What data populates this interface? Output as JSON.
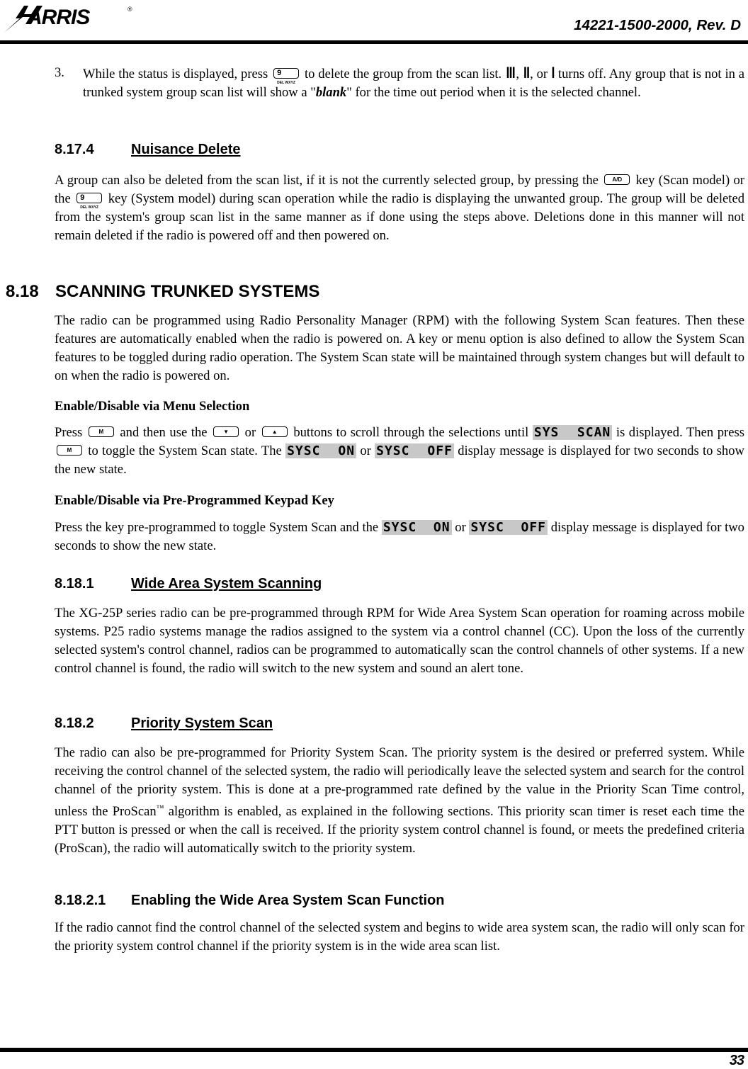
{
  "header": {
    "logo_text": "HARRIS",
    "registered_mark": "®",
    "doc_number": "14221-1500-2000, Rev. D"
  },
  "footer": {
    "page_number": "33"
  },
  "keys": {
    "nine_digit": "9",
    "nine_letters": "DEL WXYZ",
    "ad": "A/D",
    "m": "M",
    "down": "▼",
    "up": "▲"
  },
  "step3": {
    "number": "3.",
    "text_a": "While the status is displayed, press",
    "text_b": "to delete the group from the scan list.",
    "bars3": "III",
    "bars2": "II",
    "bars1": "I",
    "sep1": ", ",
    "sep2": ", or ",
    "text_c": " turns off. Any group that is not in a trunked system group scan list will show a \"",
    "blank": "blank",
    "text_d": "\" for the time out period when it is the selected channel."
  },
  "s8174": {
    "number": "8.17.4",
    "title": "Nuisance Delete",
    "p_a": "A group can also be deleted from the scan list, if it is not the currently selected group, by pressing the",
    "p_b": "key (Scan model) or the",
    "p_c": "key (System model) during scan operation while the radio is displaying the unwanted group. The group will be deleted from the system's group scan list in the same manner as if done using the steps above. Deletions done in this manner will not remain deleted if the radio is powered off and then powered on."
  },
  "s818": {
    "number": "8.18",
    "title": "SCANNING TRUNKED SYSTEMS",
    "intro": "The radio can be programmed using Radio Personality Manager (RPM) with the following System Scan features. Then these features are automatically enabled when the radio is powered on. A key or menu option is also defined to allow the System Scan features to be toggled during radio operation. The System Scan state will be maintained through system changes but will default to on when the radio is powered on.",
    "menu_heading": "Enable/Disable via Menu Selection",
    "menu_a": "Press",
    "menu_b": "and then use the",
    "menu_c": "or",
    "menu_d": "buttons to scroll through the selections until",
    "lcd_sys_scan": "SYS  SCAN",
    "menu_e": "is displayed. Then press",
    "menu_f": "to toggle the System Scan state. The",
    "lcd_sysc_on": "SYSC  ON",
    "menu_g": "or",
    "lcd_sysc_off": "SYSC  OFF",
    "menu_h": "display message is displayed for two seconds to show the new state.",
    "keypad_heading": "Enable/Disable via Pre-Programmed Keypad Key",
    "keypad_a": "Press the key pre-programmed to toggle System Scan and the",
    "keypad_b": "or",
    "keypad_c": "display message is displayed for two seconds to show the new state."
  },
  "s8181": {
    "number": "8.18.1",
    "title": "Wide Area System Scanning",
    "body": "The XG-25P series radio can be pre-programmed through RPM for Wide Area System Scan operation for roaming across mobile systems.  P25 radio systems manage the radios assigned to the system via a control channel (CC).  Upon the loss of the currently selected system's control channel, radios can be programmed to automatically scan the control channels of other systems. If a new control channel is found, the radio will switch to the new system and sound an alert tone."
  },
  "s8182": {
    "number": "8.18.2",
    "title": "Priority System Scan",
    "body_a": "The radio can also be pre-programmed for Priority System Scan.  The priority system is the desired or preferred system.  While receiving the control channel of the selected system, the radio will periodically leave the selected system and search for the control channel of the priority system.  This is done at a pre-programmed rate defined by the value in the Priority Scan Time control, unless the ProScan",
    "tm": "™",
    "body_b": " algorithm is enabled, as explained in the following sections.  This priority scan timer is reset each time the PTT button is pressed or when the call is received.  If the priority system control channel is found, or meets the predefined criteria (ProScan), the radio will automatically switch to the priority system."
  },
  "s81821": {
    "number": "8.18.2.1",
    "title": "Enabling the Wide Area System Scan Function",
    "body": "If the radio cannot find the control channel of the selected system and begins to wide area system scan, the radio will only scan for the priority system control channel if the priority system is in the wide area scan list."
  }
}
